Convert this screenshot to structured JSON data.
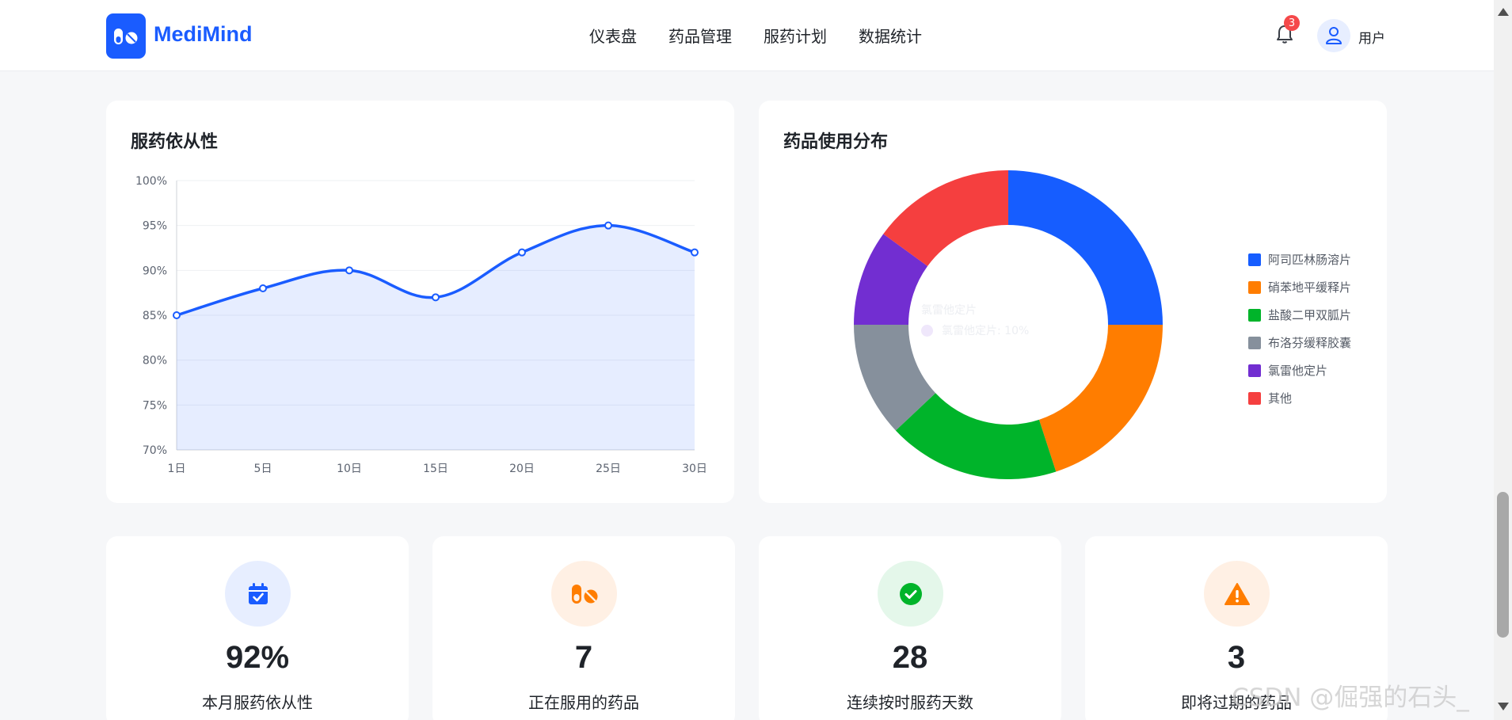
{
  "app": {
    "brand": "MediMind",
    "nav": [
      "仪表盘",
      "药品管理",
      "服药计划",
      "数据统计"
    ],
    "notification_count": "3",
    "user_name": "用户"
  },
  "adherence_card": {
    "title": "服药依从性"
  },
  "distribution_card": {
    "title": "药品使用分布",
    "ghost_tooltip_title": "氯雷他定片",
    "ghost_tooltip_text": "氯雷他定片: 10%"
  },
  "stats": [
    {
      "value": "92%",
      "label": "本月服药依从性",
      "icon": "calendar-check-icon",
      "color": "#1a5cff",
      "bg": "#e7eeff"
    },
    {
      "value": "7",
      "label": "正在服用的药品",
      "icon": "pills-icon",
      "color": "#ff7d00",
      "bg": "#fff0e4"
    },
    {
      "value": "28",
      "label": "连续按时服药天数",
      "icon": "check-circle-icon",
      "color": "#00b42a",
      "bg": "#e4f7ea"
    },
    {
      "value": "3",
      "label": "即将过期的药品",
      "icon": "warning-icon",
      "color": "#ff7d00",
      "bg": "#fff0e4"
    }
  ],
  "watermark": "CSDN @倔强的石头_",
  "chart_data": [
    {
      "type": "area",
      "title": "服药依从性",
      "x": [
        "1日",
        "5日",
        "10日",
        "15日",
        "20日",
        "25日",
        "30日"
      ],
      "series": [
        {
          "values": [
            85,
            88,
            90,
            87,
            92,
            95,
            92
          ]
        }
      ],
      "ylim": [
        70,
        100
      ],
      "yticks": [
        "70%",
        "75%",
        "80%",
        "85%",
        "90%",
        "95%",
        "100%"
      ],
      "grid": true,
      "color": "#1a5cff"
    },
    {
      "type": "pie",
      "title": "药品使用分布",
      "donut": true,
      "legend_position": "right",
      "categories": [
        "阿司匹林肠溶片",
        "硝苯地平缓释片",
        "盐酸二甲双胍片",
        "布洛芬缓释胶囊",
        "氯雷他定片",
        "其他"
      ],
      "values": [
        25,
        20,
        18,
        12,
        10,
        15
      ],
      "colors": [
        "#165dff",
        "#ff7d00",
        "#00b42a",
        "#86909c",
        "#722ed1",
        "#f53f3f"
      ]
    }
  ]
}
